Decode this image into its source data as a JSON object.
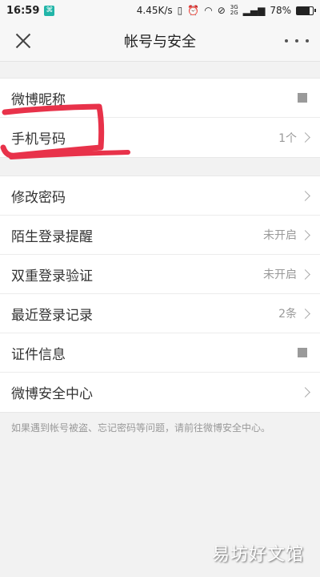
{
  "status_bar": {
    "time": "16:59",
    "network_speed": "4.45K/s",
    "network_type_top": "3G",
    "network_type_bottom": "2G",
    "battery_percent": 78,
    "battery_label": "78%"
  },
  "header": {
    "title": "帐号与安全"
  },
  "groups": [
    {
      "items": [
        {
          "label": "微博昵称",
          "value": ""
        },
        {
          "label": "手机号码",
          "value": "1个"
        }
      ]
    },
    {
      "items": [
        {
          "label": "修改密码",
          "value": ""
        },
        {
          "label": "陌生登录提醒",
          "value": "未开启"
        },
        {
          "label": "双重登录验证",
          "value": "未开启"
        },
        {
          "label": "最近登录记录",
          "value": "2条"
        },
        {
          "label": "证件信息",
          "value": ""
        },
        {
          "label": "微博安全中心",
          "value": ""
        }
      ]
    }
  ],
  "footnote": "如果遇到帐号被盗、忘记密码等问题，请前往微博安全中心。",
  "watermark": "易坊好文馆",
  "colors": {
    "annotation": "#e8324a",
    "background": "#f2f2f2",
    "value_text": "#999999"
  }
}
